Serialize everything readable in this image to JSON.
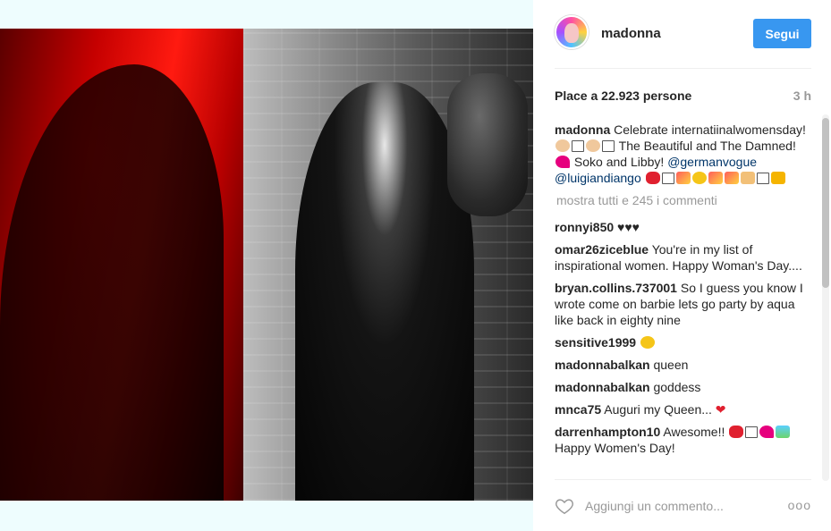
{
  "post": {
    "username": "madonna",
    "follow_label": "Segui",
    "likes_text": "Place a 22.923 persone",
    "time_ago": "3 h"
  },
  "caption": {
    "username": "madonna",
    "text_1": "Celebrate internatiinalwomensday!",
    "text_2": "The Beautiful and The Damned!",
    "text_3": "Soko and Libby!",
    "mention_1": "@germanvogue",
    "mention_2": "@luigiandiango"
  },
  "show_all_comments": "mostra tutti e 245 i commenti",
  "comments": [
    {
      "username": "ronnyi850",
      "text": "♥♥♥"
    },
    {
      "username": "omar26ziceblue",
      "text": "You're in my list of inspirational women. Happy Woman's Day...."
    },
    {
      "username": "bryan.collins.737001",
      "text": "So I guess you know I wrote come on barbie lets go party by aqua like back in eighty nine"
    },
    {
      "username": "sensitive1999",
      "text": ""
    },
    {
      "username": "madonnabalkan",
      "text": "queen"
    },
    {
      "username": "madonnabalkan",
      "text": "goddess"
    },
    {
      "username": "mnca75",
      "text": "Auguri my Queen..."
    },
    {
      "username": "darrenhampton10",
      "text": "Awesome!!"
    },
    {
      "username": "",
      "text": "Happy Women's Day!"
    }
  ],
  "footer": {
    "comment_placeholder": "Aggiungi un commento...",
    "more_label": "ooo"
  },
  "icons": {
    "like": "heart-outline-icon",
    "more": "ellipsis-icon"
  },
  "colors": {
    "follow_button": "#3897f0",
    "link": "#003569",
    "muted": "#999999"
  }
}
